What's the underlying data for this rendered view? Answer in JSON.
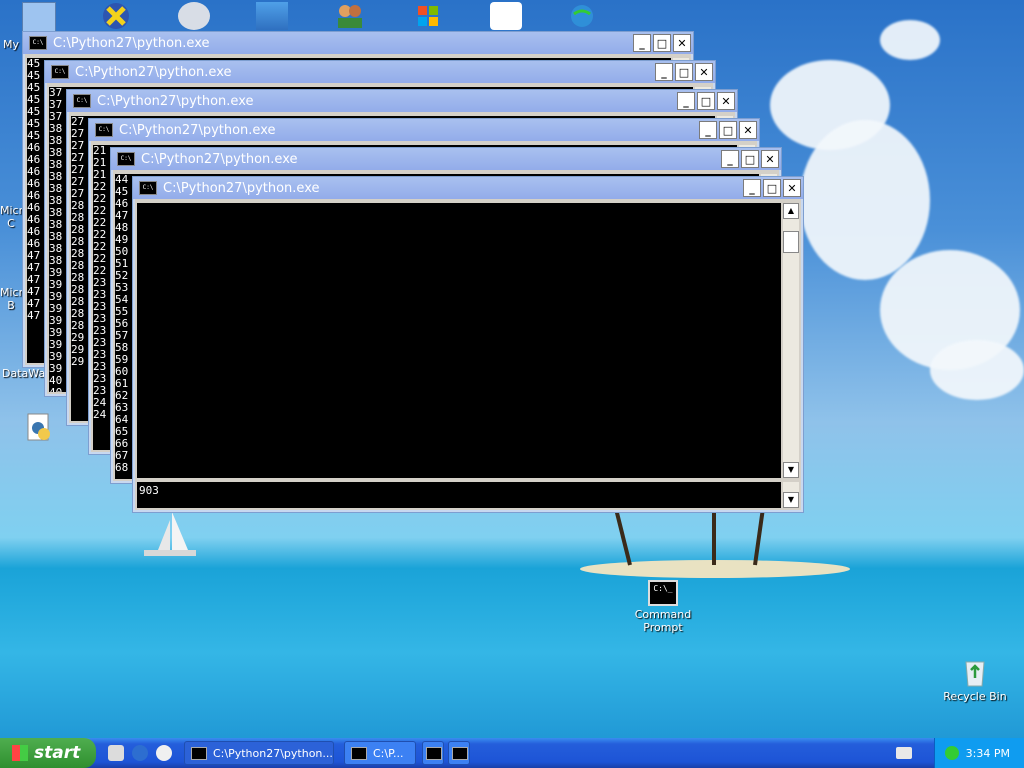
{
  "desktop": {
    "icons": [
      {
        "label": "My",
        "icon": "my-computer-icon"
      },
      {
        "label": "Micro C",
        "icon": "office-icon"
      },
      {
        "label": "Micro B",
        "icon": "office-icon"
      },
      {
        "label": "DataWa",
        "icon": "app-icon"
      },
      {
        "label": "",
        "icon": "python-file-icon"
      },
      {
        "label": "Command Prompt",
        "icon": "command-prompt-icon"
      },
      {
        "label": "Recycle Bin",
        "icon": "recycle-bin-icon"
      }
    ]
  },
  "windows": [
    {
      "title": "C:\\Python27\\python.exe",
      "lines": [
        "45",
        "45",
        "45",
        "45",
        "45",
        "45",
        "45",
        "46",
        "46",
        "46",
        "46",
        "46",
        "46",
        "46",
        "46",
        "46",
        "47",
        "47",
        "47",
        "47",
        "47",
        "47"
      ]
    },
    {
      "title": "C:\\Python27\\python.exe",
      "lines": [
        "37",
        "37",
        "37",
        "38",
        "38",
        "38",
        "38",
        "38",
        "38",
        "38",
        "38",
        "38",
        "38",
        "38",
        "38",
        "39",
        "39",
        "39",
        "39",
        "39",
        "39",
        "39",
        "39",
        "39",
        "40",
        "40"
      ]
    },
    {
      "title": "C:\\Python27\\python.exe",
      "lines": [
        "27",
        "27",
        "27",
        "27",
        "27",
        "27",
        "27",
        "28",
        "28",
        "28",
        "28",
        "28",
        "28",
        "28",
        "28",
        "28",
        "28",
        "28",
        "29",
        "29",
        "29"
      ]
    },
    {
      "title": "C:\\Python27\\python.exe",
      "lines": [
        "21",
        "21",
        "21",
        "22",
        "22",
        "22",
        "22",
        "22",
        "22",
        "22",
        "22",
        "23",
        "23",
        "23",
        "23",
        "23",
        "23",
        "23",
        "23",
        "23",
        "23",
        "24",
        "24"
      ]
    },
    {
      "title": "C:\\Python27\\python.exe",
      "lines": [
        "44",
        "45",
        "46",
        "47",
        "48",
        "49",
        "50",
        "51",
        "52",
        "53",
        "54",
        "55",
        "56",
        "57",
        "58",
        "59",
        "60",
        "61",
        "62",
        "63",
        "64",
        "65",
        "66",
        "67",
        "68"
      ]
    },
    {
      "title": "C:\\Python27\\python.exe",
      "lines": [],
      "bottom_line": "903"
    }
  ],
  "taskbar": {
    "start_label": "start",
    "items": [
      {
        "label": "C:\\Python27\\python...."
      },
      {
        "label": "C:\\P..."
      },
      {
        "label": ""
      },
      {
        "label": ""
      }
    ],
    "clock": "3:34 PM"
  }
}
